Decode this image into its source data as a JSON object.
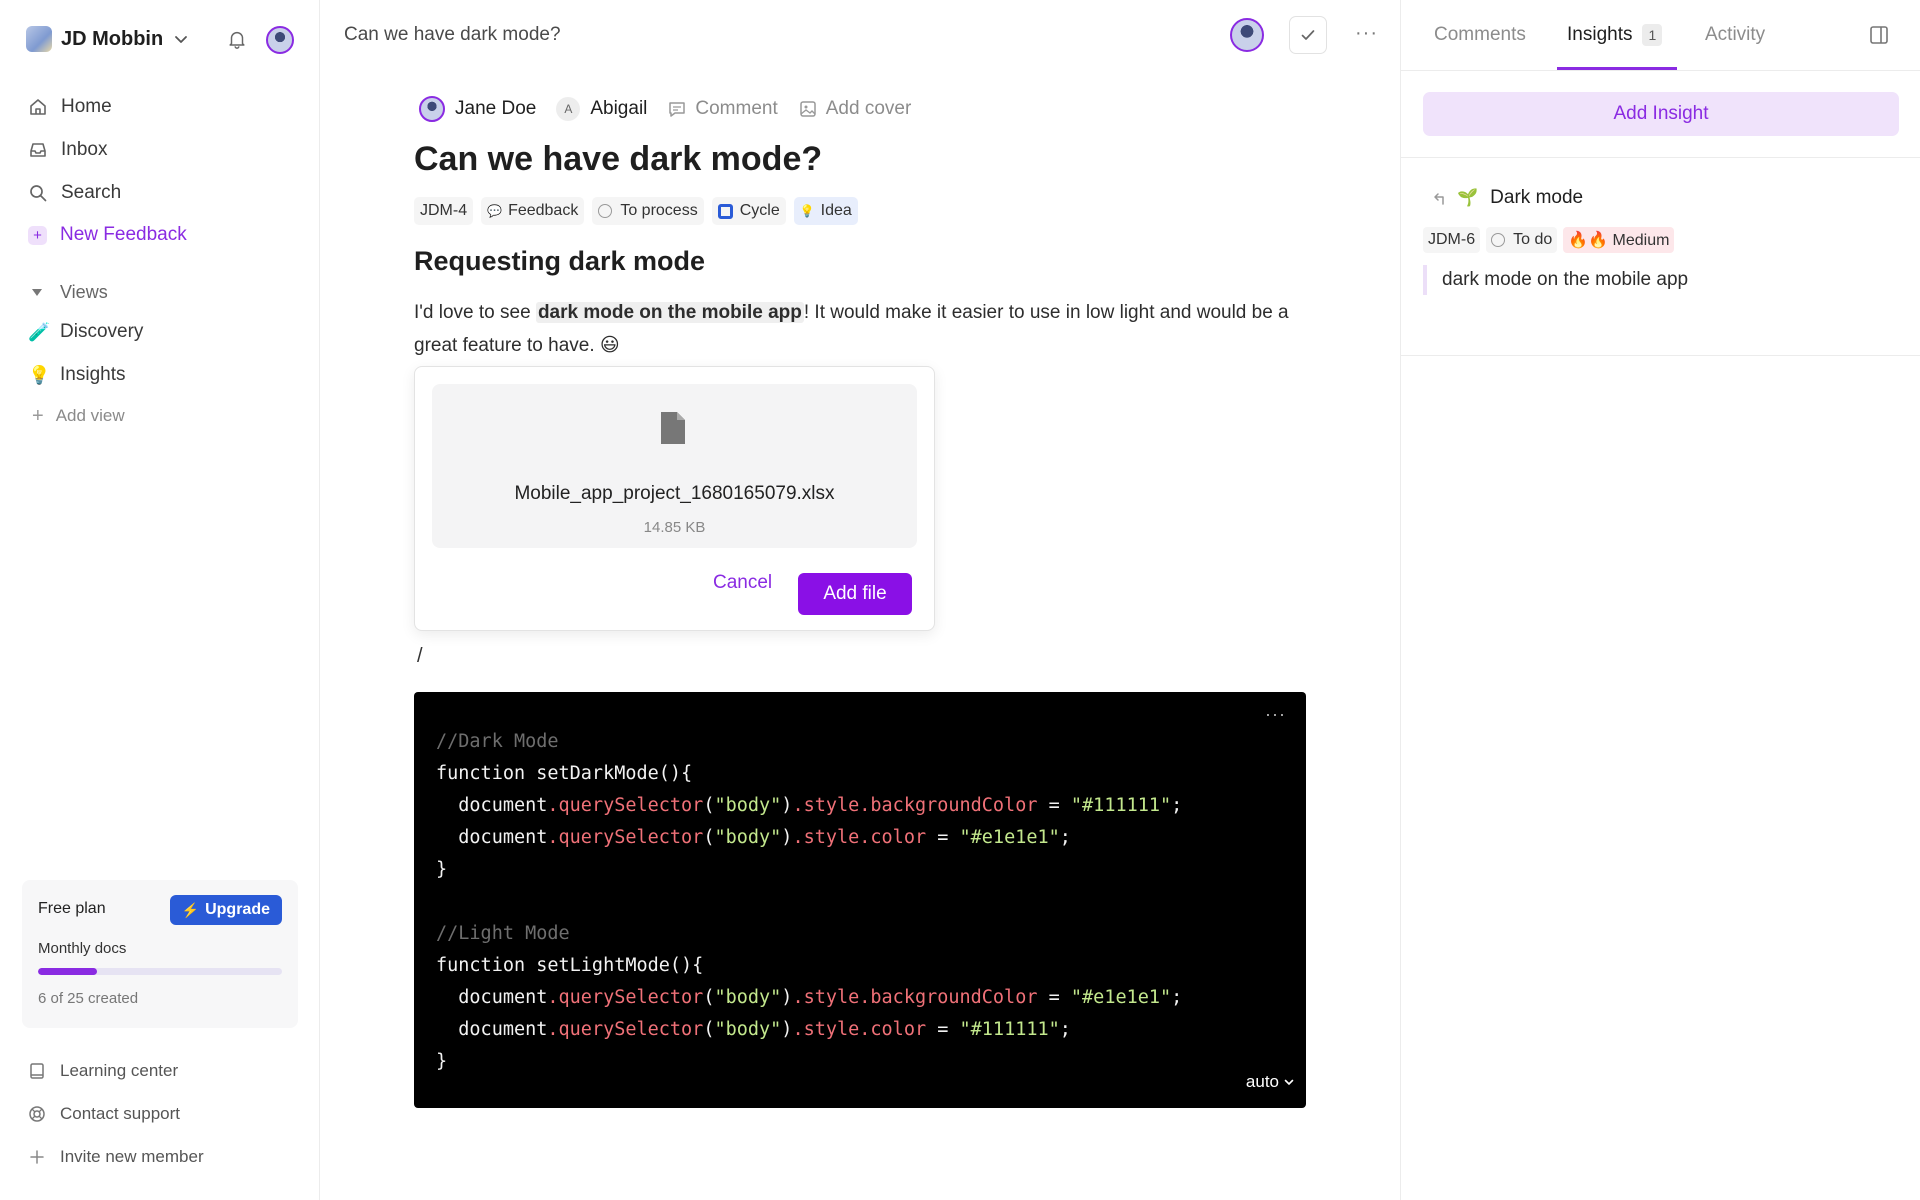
{
  "workspace": {
    "name": "JD Mobbin"
  },
  "nav": {
    "home": "Home",
    "inbox": "Inbox",
    "search": "Search",
    "new_feedback": "New Feedback"
  },
  "views": {
    "header": "Views",
    "items": [
      {
        "label": "Discovery",
        "emoji": "🧪"
      },
      {
        "label": "Insights",
        "emoji": "💡"
      }
    ],
    "add_view": "Add view"
  },
  "plan": {
    "title": "Free plan",
    "upgrade": "Upgrade",
    "monthly": "Monthly docs",
    "used": 6,
    "limit": 25,
    "created_text": "6 of 25 created"
  },
  "bottom_nav": {
    "learning": "Learning center",
    "support": "Contact support",
    "invite": "Invite new member"
  },
  "topbar": {
    "title": "Can we have dark mode?",
    "more": "···"
  },
  "doc": {
    "author": "Jane Doe",
    "assignee_initial": "A",
    "assignee": "Abigail",
    "comment": "Comment",
    "add_cover": "Add cover",
    "title": "Can we have dark mode?",
    "tags": {
      "id": "JDM-4",
      "type": "Feedback",
      "status": "To process",
      "cycle": "Cycle",
      "idea": "Idea"
    },
    "heading": "Requesting dark mode",
    "para_before": "I'd love to see ",
    "para_highlight": "dark mode on the mobile app",
    "para_after": "! It would make it easier to use in low light and would be a great feature to have. 😃",
    "slash": "/"
  },
  "upload": {
    "file_name": "Mobile_app_project_1680165079.xlsx",
    "file_size": "14.85 KB",
    "cancel": "Cancel",
    "add": "Add file"
  },
  "code": {
    "more": "···",
    "language": "auto",
    "comment_dark": "//Dark Mode",
    "comment_light": "//Light Mode",
    "fn_dark": "function setDarkMode(){",
    "fn_light": "function setLightMode(){",
    "doc": "document",
    "qs": ".querySelector",
    "body_arg": "\"body\"",
    "style_bg": ".style.backgroundColor",
    "style_color": ".style.color",
    "val_111": "\"#111111\"",
    "val_e1e": "\"#e1e1e1\"",
    "close": "}"
  },
  "right": {
    "tabs": {
      "comments": "Comments",
      "insights": "Insights",
      "insights_count": "1",
      "activity": "Activity"
    },
    "add_insight": "Add Insight",
    "insight": {
      "title": "Dark mode",
      "emoji": "🌱",
      "id": "JDM-6",
      "status": "To do",
      "priority": "🔥🔥 Medium",
      "quote": "dark mode on the mobile app"
    }
  },
  "colors": {
    "accent": "#8a2be2",
    "upgrade": "#2a5bd7",
    "code_bg": "#000000"
  }
}
